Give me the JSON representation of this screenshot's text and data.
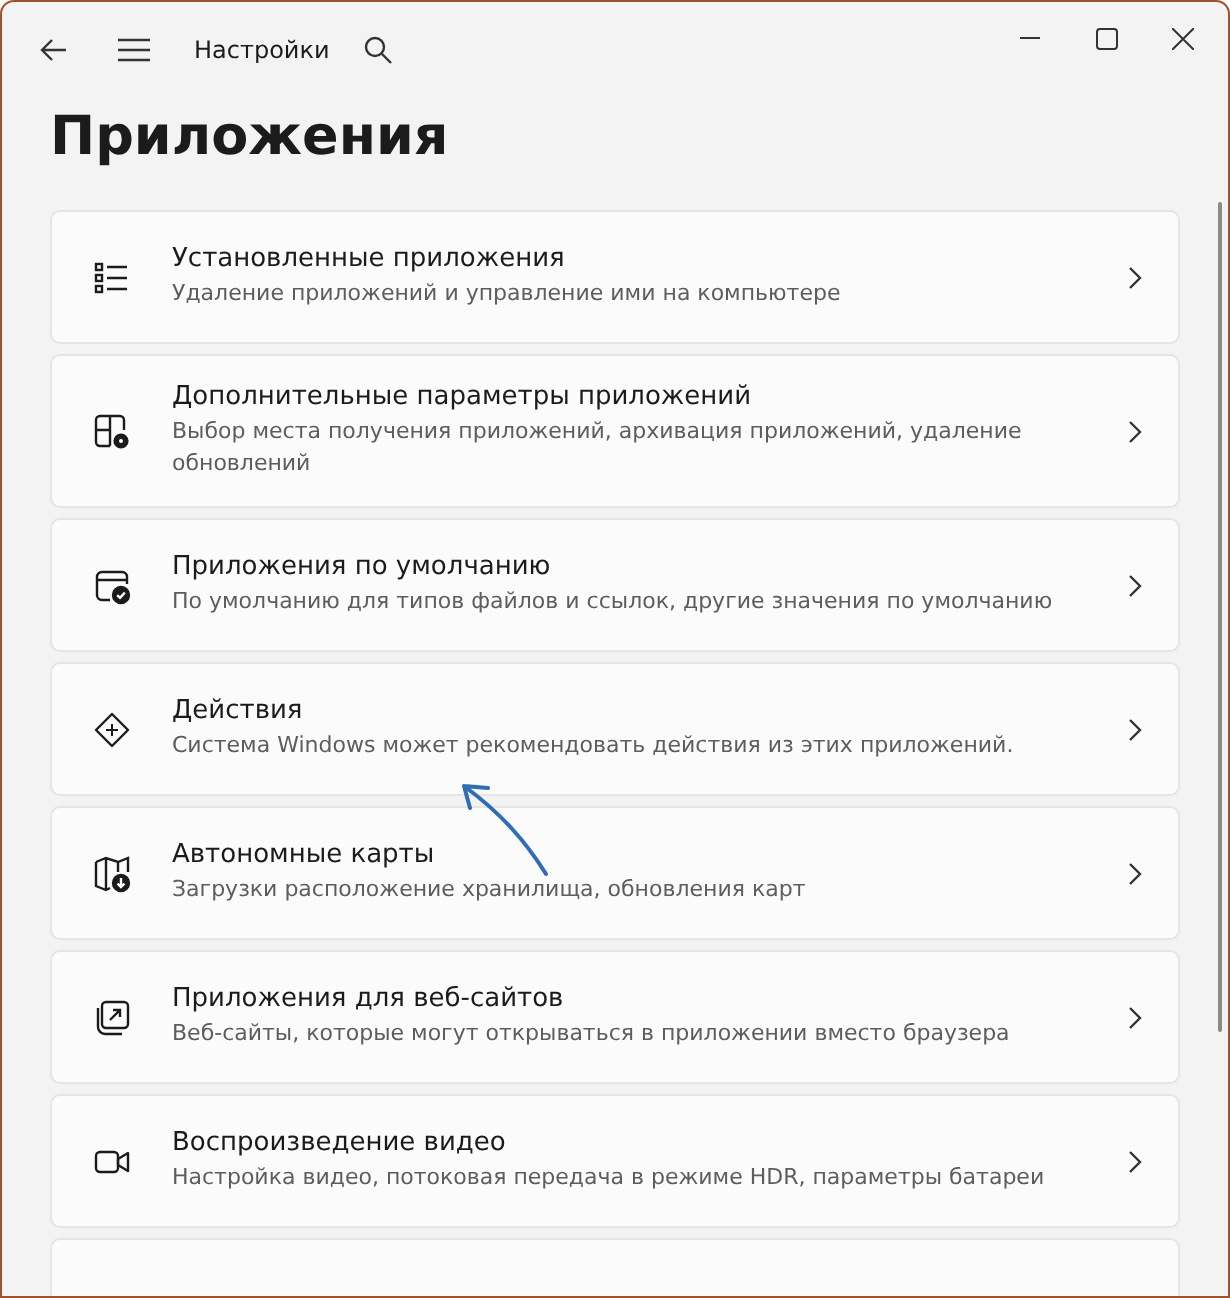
{
  "window": {
    "title": "Настройки"
  },
  "page_title": "Приложения",
  "items": [
    {
      "kind": "list",
      "title": "Установленные приложения",
      "description": "Удаление приложений и управление ими на компьютере"
    },
    {
      "kind": "gear",
      "title": "Дополнительные параметры приложений",
      "description": "Выбор места получения приложений, архивация приложений, удаление обновлений"
    },
    {
      "kind": "default",
      "title": "Приложения по умолчанию",
      "description": "По умолчанию для типов файлов и ссылок, другие значения по умолчанию"
    },
    {
      "kind": "actions",
      "title": "Действия",
      "description": "Система Windows может рекомендовать действия из этих приложений."
    },
    {
      "kind": "map",
      "title": "Автономные карты",
      "description": "Загрузки расположение хранилища, обновления карт"
    },
    {
      "kind": "web",
      "title": "Приложения для веб-сайтов",
      "description": "Веб-сайты, которые могут открываться в приложении вместо браузера"
    },
    {
      "kind": "video",
      "title": "Воспроизведение видео",
      "description": "Настройка видео, потоковая передача в режиме HDR, параметры батареи"
    }
  ]
}
